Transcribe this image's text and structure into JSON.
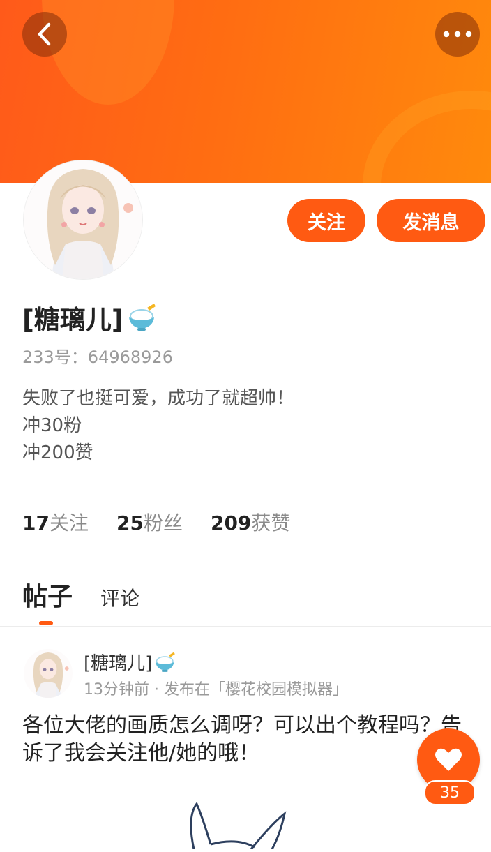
{
  "header": {
    "back_icon": "chevron-left-icon",
    "more_icon": "more-dots-icon",
    "banner_colors": [
      "#ff5a1a",
      "#ff8a0c"
    ]
  },
  "profile": {
    "name": "[糖璃儿]",
    "badge_icon": "rice-bowl-badge-icon",
    "uid": "233号：64968926",
    "bio": [
      "失败了也挺可爱，成功了就超帅！",
      "冲30粉",
      "冲200赞"
    ],
    "follow_label": "关注",
    "message_label": "发消息"
  },
  "stats": [
    {
      "num": "17",
      "label": "关注"
    },
    {
      "num": "25",
      "label": "粉丝"
    },
    {
      "num": "209",
      "label": "获赞"
    }
  ],
  "tabs": {
    "posts": "帖子",
    "comments": "评论",
    "active": "posts"
  },
  "post": {
    "author": "[糖璃儿]",
    "meta": "13分钟前 · 发布在「樱花校园模拟器」",
    "text": "各位大佬的画质怎么调呀？可以出个教程吗？告诉了我会关注他/她的哦！",
    "likes": "35"
  },
  "accent": "#ff5a12"
}
